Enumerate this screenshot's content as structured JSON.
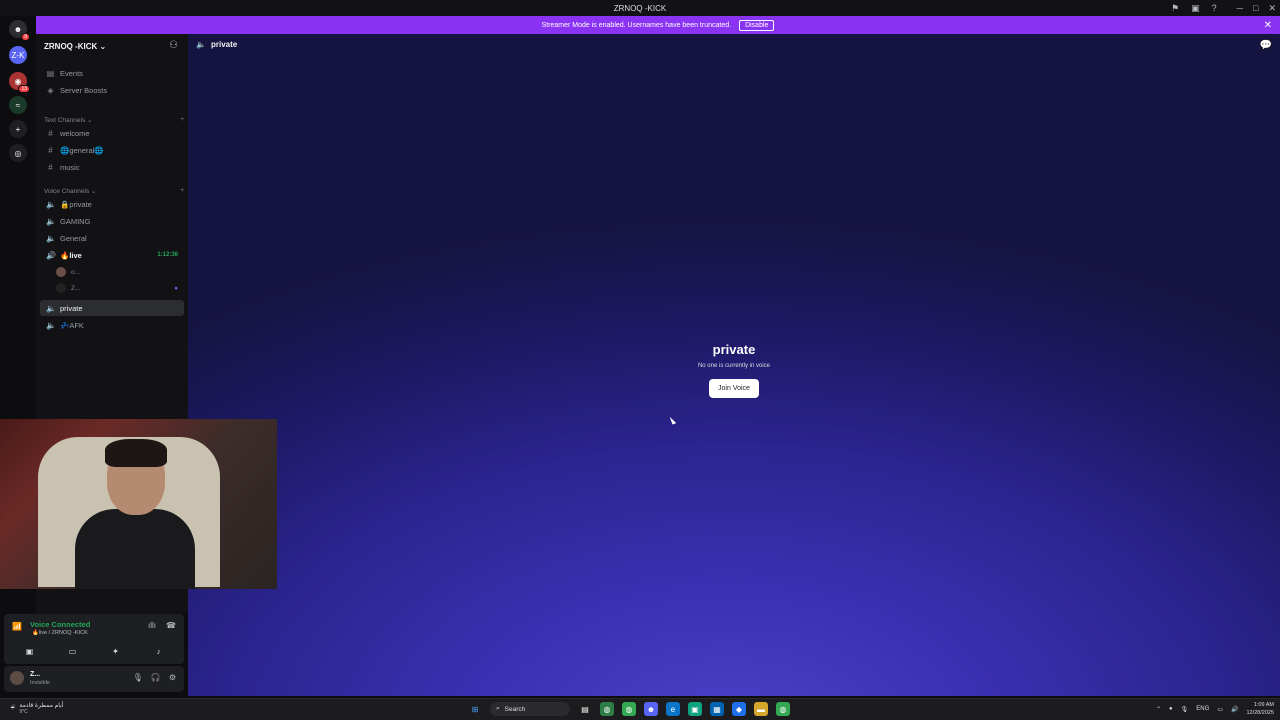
{
  "titlebar": {
    "title": "ZRNOQ -KICK"
  },
  "banner": {
    "message": "Streamer Mode is enabled. Usernames have been truncated.",
    "disable_label": "Disable"
  },
  "guilds": [
    {
      "name": "home",
      "icon": "discord-icon",
      "badge": "9"
    },
    {
      "name": "Z-K",
      "icon": "server-avatar",
      "badge": ""
    },
    {
      "name": "server-2",
      "icon": "server-avatar",
      "badge": "13"
    },
    {
      "name": "server-3",
      "icon": "server-avatar",
      "badge": ""
    }
  ],
  "server": {
    "name": "ZRNOQ -KICK"
  },
  "sidebar_top": [
    {
      "label": "Events",
      "icon": "calendar-icon"
    },
    {
      "label": "Server Boosts",
      "icon": "boost-icon"
    }
  ],
  "text_category": "Text Channels",
  "text_channels": [
    {
      "label": "welcome"
    },
    {
      "label": "🌐general🌐"
    },
    {
      "label": "music"
    }
  ],
  "voice_category": "Voice Channels",
  "voice_channels": [
    {
      "label": "🔒private"
    },
    {
      "label": "GAMING"
    },
    {
      "label": "General"
    },
    {
      "label": "🔥live",
      "time": "1:12:36"
    }
  ],
  "participants": [
    {
      "label": "o..."
    },
    {
      "label": "Z..."
    }
  ],
  "voice_channels_after": [
    {
      "label": "private"
    },
    {
      "label": "💤AFK"
    }
  ],
  "main": {
    "channel_name": "private",
    "heading": "private",
    "subtext": "No one is currently in voice",
    "join_label": "Join Voice"
  },
  "voice_panel": {
    "title": "Voice Connected",
    "subtitle": "🔥live / ZRNOQ -KICK"
  },
  "user": {
    "name": "Z...",
    "status": "Invisible"
  },
  "taskbar": {
    "weather_text": "أيام ممطرة قادمة",
    "temp": "9°C",
    "search_label": "Search",
    "lang": "ENG",
    "time": "1:09 AM",
    "date": "12/28/2025"
  },
  "colors": {
    "accent": "#8b33f3",
    "voice_green": "#23a55a",
    "main_gradient_center": "#4a42c8"
  }
}
